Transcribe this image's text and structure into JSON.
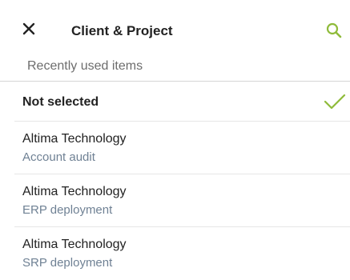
{
  "header": {
    "title": "Client & Project",
    "close_icon": "close-icon",
    "search_icon": "search-icon"
  },
  "section_label": "Recently used items",
  "not_selected": {
    "label": "Not selected",
    "checked": true,
    "check_icon": "check-icon"
  },
  "items": [
    {
      "client": "Altima Technology",
      "project": "Account audit"
    },
    {
      "client": "Altima Technology",
      "project": "ERP deployment"
    },
    {
      "client": "Altima Technology",
      "project": "SRP deployment"
    }
  ],
  "colors": {
    "accent": "#8fbb3a",
    "title": "#222222",
    "subtitle": "#6f8194",
    "muted": "#6d6d6d"
  }
}
